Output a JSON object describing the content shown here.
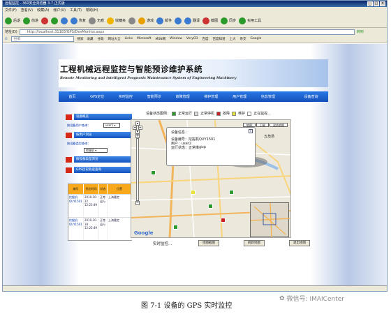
{
  "window": {
    "title": "远程监控 - 360安全浏览器 3.7 正式版"
  },
  "menu": [
    "文件(F)",
    "查看(V)",
    "收藏(A)",
    "帐户(U)",
    "工具(T)",
    "帮助(H)"
  ],
  "toolbar": [
    {
      "label": "后退",
      "icon": "back-arrow-icon",
      "color": "#2a9b2a"
    },
    {
      "label": "前进",
      "icon": "forward-arrow-icon",
      "color": "#2a9b2a"
    },
    {
      "label": "",
      "icon": "stop-icon",
      "color": "#c33"
    },
    {
      "label": "",
      "icon": "refresh-icon",
      "color": "#2a9b2a"
    },
    {
      "label": "",
      "icon": "home-icon",
      "color": "#3a7ad0"
    },
    {
      "label": "恢复",
      "icon": "restore-icon",
      "color": "#3a7ad0"
    },
    {
      "label": "无痕",
      "icon": "incognito-icon",
      "color": "#888"
    },
    {
      "label": "收藏夹",
      "icon": "star-icon",
      "color": "#f0b400"
    },
    {
      "label": "",
      "icon": "swirl-icon",
      "color": "#888"
    },
    {
      "label": "游戏",
      "icon": "game-icon",
      "color": "#e8a000"
    },
    {
      "label": "邮件",
      "icon": "mail-icon",
      "color": "#3a7ad0"
    },
    {
      "label": "",
      "icon": "tab-icon",
      "color": "#3a7ad0"
    },
    {
      "label": "翻译",
      "icon": "translate-icon",
      "color": "#3a7ad0"
    },
    {
      "label": "截图",
      "icon": "scissors-icon",
      "color": "#c33"
    },
    {
      "label": "同步",
      "icon": "sync-icon",
      "color": "#2a9b2a"
    },
    {
      "label": "实用工具",
      "icon": "tools-icon",
      "color": "#2a9b2a"
    }
  ],
  "address": {
    "label": "地址(D)",
    "value": "http://localhost:31183/GPS/DevMonitor.aspx",
    "go_label": "转到"
  },
  "links": {
    "search_placeholder": "谷歌",
    "search_button": "搜索",
    "items": [
      "收藏",
      "谷歌",
      "网址大全",
      "Links",
      "Microsoft",
      "MSN网",
      "Window",
      "VeryCD",
      "百度",
      "百度知道",
      "上大",
      "杂交",
      "Google"
    ]
  },
  "banner": {
    "title": "工程机械远程监控与智能预诊维护系统",
    "subtitle": "Remote Monitoring and Intelligent Prognosis Maintenance System of Engineering Machinery"
  },
  "nav": [
    "首页",
    "GPS定位",
    "实时监控",
    "智能预诊",
    "故障管理",
    "维护管理",
    "用户管理",
    "信息管理",
    "",
    "设备查询"
  ],
  "sidebar": {
    "sec1": "设备概览",
    "user_label": "按设备用户查询：",
    "user_value": "user1",
    "sec2": "按用户浏览",
    "type_label": "按设备类型查询：",
    "type_value": "挖掘机",
    "sec3": "按设备类型浏览",
    "sec4": "GPS历史轨迹查询"
  },
  "table": {
    "headers": [
      "编号",
      "到达时间",
      "状态",
      "位置"
    ],
    "rows": [
      {
        "no": "挖掘机 QUY1501",
        "time": "2010-10-22 12:23:49",
        "state": "正常运行",
        "pos": "上海嘉定"
      },
      {
        "no": "挖掘机 QUY1501",
        "time": "2010-10-18 12:25:49",
        "state": "正常运行",
        "pos": "上海嘉定"
      }
    ]
  },
  "legend": {
    "label": "设备状态图例：",
    "items": [
      {
        "label": "正常运行",
        "color": "#2e9a2e"
      },
      {
        "label": "正常停机",
        "color": "#d8d8d8"
      },
      {
        "label": "故障",
        "color": "#c62020"
      },
      {
        "label": "维护",
        "color": "#e8e23a"
      },
      {
        "label": "正在监控...",
        "color": "#ffffff"
      }
    ]
  },
  "map": {
    "types": [
      "地图",
      "卫星",
      "混合地图"
    ],
    "popup": {
      "title": "设备信息：",
      "lines": [
        "设备编号：挖掘机QUY1501",
        "用户：user2",
        "运行状态：正常维护中"
      ]
    },
    "place_label": "五角场",
    "logo": "Google"
  },
  "controls": {
    "status": "实时监控...",
    "buttons": [
      "地图截图",
      "刷新地图",
      "退出地图"
    ]
  },
  "figure": {
    "caption": "图 7-1  设备的 GPS 实时监控"
  },
  "watermark": "微信号: IMAICenter"
}
